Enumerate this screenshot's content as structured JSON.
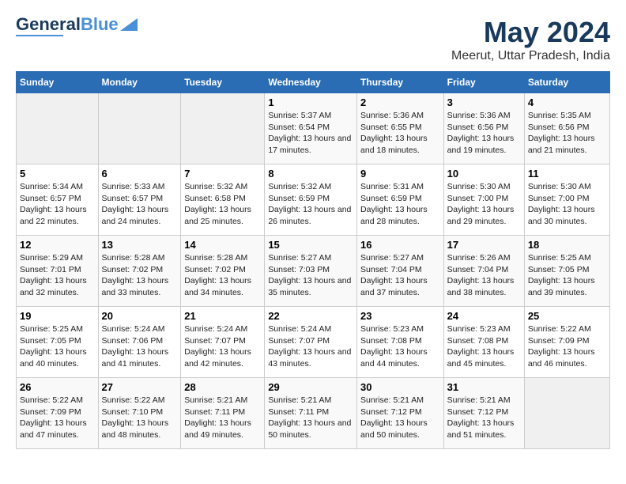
{
  "logo": {
    "text_general": "General",
    "text_blue": "Blue"
  },
  "title": "May 2024",
  "subtitle": "Meerut, Uttar Pradesh, India",
  "days_of_week": [
    "Sunday",
    "Monday",
    "Tuesday",
    "Wednesday",
    "Thursday",
    "Friday",
    "Saturday"
  ],
  "weeks": [
    [
      {
        "day": "",
        "empty": true
      },
      {
        "day": "",
        "empty": true
      },
      {
        "day": "",
        "empty": true
      },
      {
        "day": "1",
        "sunrise": "5:37 AM",
        "sunset": "6:54 PM",
        "daylight": "13 hours and 17 minutes."
      },
      {
        "day": "2",
        "sunrise": "5:36 AM",
        "sunset": "6:55 PM",
        "daylight": "13 hours and 18 minutes."
      },
      {
        "day": "3",
        "sunrise": "5:36 AM",
        "sunset": "6:56 PM",
        "daylight": "13 hours and 19 minutes."
      },
      {
        "day": "4",
        "sunrise": "5:35 AM",
        "sunset": "6:56 PM",
        "daylight": "13 hours and 21 minutes."
      }
    ],
    [
      {
        "day": "5",
        "sunrise": "5:34 AM",
        "sunset": "6:57 PM",
        "daylight": "13 hours and 22 minutes."
      },
      {
        "day": "6",
        "sunrise": "5:33 AM",
        "sunset": "6:57 PM",
        "daylight": "13 hours and 24 minutes."
      },
      {
        "day": "7",
        "sunrise": "5:32 AM",
        "sunset": "6:58 PM",
        "daylight": "13 hours and 25 minutes."
      },
      {
        "day": "8",
        "sunrise": "5:32 AM",
        "sunset": "6:59 PM",
        "daylight": "13 hours and 26 minutes."
      },
      {
        "day": "9",
        "sunrise": "5:31 AM",
        "sunset": "6:59 PM",
        "daylight": "13 hours and 28 minutes."
      },
      {
        "day": "10",
        "sunrise": "5:30 AM",
        "sunset": "7:00 PM",
        "daylight": "13 hours and 29 minutes."
      },
      {
        "day": "11",
        "sunrise": "5:30 AM",
        "sunset": "7:00 PM",
        "daylight": "13 hours and 30 minutes."
      }
    ],
    [
      {
        "day": "12",
        "sunrise": "5:29 AM",
        "sunset": "7:01 PM",
        "daylight": "13 hours and 32 minutes."
      },
      {
        "day": "13",
        "sunrise": "5:28 AM",
        "sunset": "7:02 PM",
        "daylight": "13 hours and 33 minutes."
      },
      {
        "day": "14",
        "sunrise": "5:28 AM",
        "sunset": "7:02 PM",
        "daylight": "13 hours and 34 minutes."
      },
      {
        "day": "15",
        "sunrise": "5:27 AM",
        "sunset": "7:03 PM",
        "daylight": "13 hours and 35 minutes."
      },
      {
        "day": "16",
        "sunrise": "5:27 AM",
        "sunset": "7:04 PM",
        "daylight": "13 hours and 37 minutes."
      },
      {
        "day": "17",
        "sunrise": "5:26 AM",
        "sunset": "7:04 PM",
        "daylight": "13 hours and 38 minutes."
      },
      {
        "day": "18",
        "sunrise": "5:25 AM",
        "sunset": "7:05 PM",
        "daylight": "13 hours and 39 minutes."
      }
    ],
    [
      {
        "day": "19",
        "sunrise": "5:25 AM",
        "sunset": "7:05 PM",
        "daylight": "13 hours and 40 minutes."
      },
      {
        "day": "20",
        "sunrise": "5:24 AM",
        "sunset": "7:06 PM",
        "daylight": "13 hours and 41 minutes."
      },
      {
        "day": "21",
        "sunrise": "5:24 AM",
        "sunset": "7:07 PM",
        "daylight": "13 hours and 42 minutes."
      },
      {
        "day": "22",
        "sunrise": "5:24 AM",
        "sunset": "7:07 PM",
        "daylight": "13 hours and 43 minutes."
      },
      {
        "day": "23",
        "sunrise": "5:23 AM",
        "sunset": "7:08 PM",
        "daylight": "13 hours and 44 minutes."
      },
      {
        "day": "24",
        "sunrise": "5:23 AM",
        "sunset": "7:08 PM",
        "daylight": "13 hours and 45 minutes."
      },
      {
        "day": "25",
        "sunrise": "5:22 AM",
        "sunset": "7:09 PM",
        "daylight": "13 hours and 46 minutes."
      }
    ],
    [
      {
        "day": "26",
        "sunrise": "5:22 AM",
        "sunset": "7:09 PM",
        "daylight": "13 hours and 47 minutes."
      },
      {
        "day": "27",
        "sunrise": "5:22 AM",
        "sunset": "7:10 PM",
        "daylight": "13 hours and 48 minutes."
      },
      {
        "day": "28",
        "sunrise": "5:21 AM",
        "sunset": "7:11 PM",
        "daylight": "13 hours and 49 minutes."
      },
      {
        "day": "29",
        "sunrise": "5:21 AM",
        "sunset": "7:11 PM",
        "daylight": "13 hours and 50 minutes."
      },
      {
        "day": "30",
        "sunrise": "5:21 AM",
        "sunset": "7:12 PM",
        "daylight": "13 hours and 50 minutes."
      },
      {
        "day": "31",
        "sunrise": "5:21 AM",
        "sunset": "7:12 PM",
        "daylight": "13 hours and 51 minutes."
      },
      {
        "day": "",
        "empty": true
      }
    ]
  ]
}
